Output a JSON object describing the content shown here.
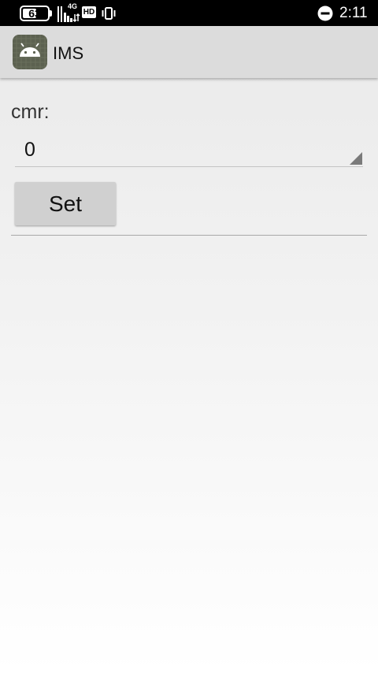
{
  "status_bar": {
    "battery_level": "63",
    "network_type": "4G",
    "hd_label": "HD",
    "time": "2:11",
    "icons": [
      "battery-icon",
      "signal-icon",
      "hd-icon",
      "vibrate-icon",
      "do-not-disturb-icon"
    ]
  },
  "app_bar": {
    "title": "IMS",
    "icon": "android-app-icon"
  },
  "form": {
    "cmr_label": "cmr:",
    "cmr_value": "0",
    "set_button_label": "Set"
  },
  "colors": {
    "status_bar_bg": "#000000",
    "app_bar_bg": "#dcdcdc",
    "app_icon_bg": "#5c6150",
    "button_bg": "#d0d0d0"
  }
}
